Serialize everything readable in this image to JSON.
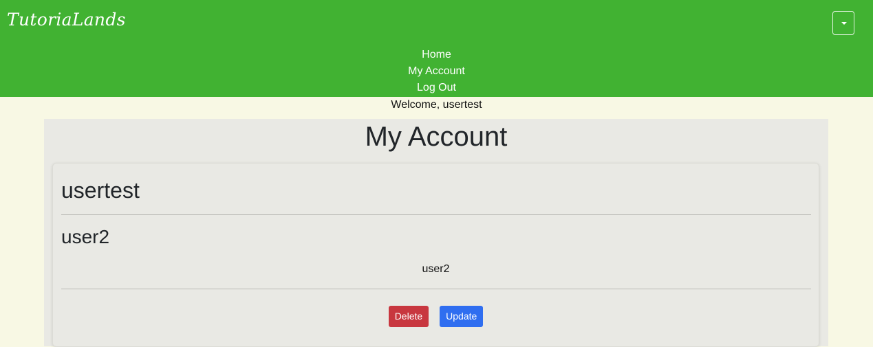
{
  "navbar": {
    "brand": "TutoriaLands",
    "toggler_icon": "caret-down-icon",
    "background": "#41b232",
    "links": [
      {
        "label": "Home"
      },
      {
        "label": "My Account"
      },
      {
        "label": "Log Out"
      }
    ]
  },
  "welcome": "Welcome, usertest",
  "main": {
    "title": "My Account",
    "card": {
      "username": "usertest",
      "subheading": "user2",
      "detail": "user2",
      "delete_label": "Delete",
      "update_label": "Update",
      "delete_color": "#c8373f",
      "update_color": "#2f6ef0"
    }
  }
}
